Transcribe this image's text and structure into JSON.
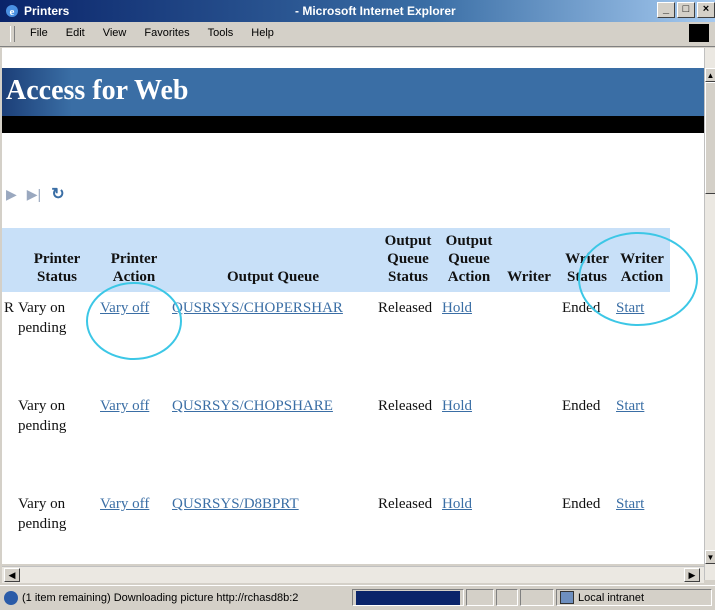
{
  "window": {
    "title": "Printers",
    "app_name": "- Microsoft Internet Explorer",
    "buttons": [
      "_",
      "□",
      "×"
    ]
  },
  "menu": [
    "File",
    "Edit",
    "View",
    "Favorites",
    "Tools",
    "Help"
  ],
  "page": {
    "banner": "Access for Web"
  },
  "table": {
    "headers": [
      "",
      "Printer Status",
      "Printer Action",
      "Output Queue",
      "Output Queue Status",
      "Output Queue Action",
      "Writer",
      "Writer Status",
      "Writer Action"
    ],
    "rows": [
      [
        "R",
        "Vary on pending",
        "Vary off",
        "QUSRSYS/CHOPERSHAR",
        "Released",
        "Hold",
        "",
        "Ended",
        "Start"
      ],
      [
        "",
        "Vary on pending",
        "Vary off",
        "QUSRSYS/CHOPSHARE",
        "Released",
        "Hold",
        "",
        "Ended",
        "Start"
      ],
      [
        "",
        "Vary on pending",
        "Vary off",
        "QUSRSYS/D8BPRT",
        "Released",
        "Hold",
        "",
        "Ended",
        "Start"
      ]
    ]
  },
  "status": {
    "message": "(1 item remaining) Downloading picture http://rchasd8b:2",
    "zone": "Local intranet"
  },
  "colors": {
    "banner": "#3a6ea5",
    "header_bg": "#c8e0f8",
    "link": "#3a6ea5",
    "highlight_circle": "#3cc7e6"
  }
}
